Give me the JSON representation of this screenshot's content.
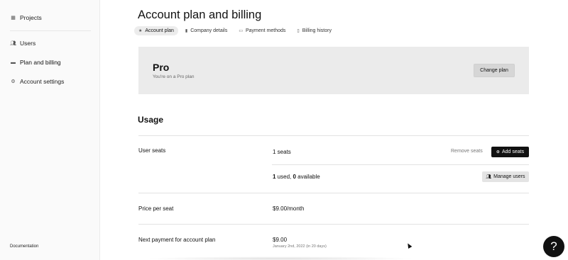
{
  "sidebar": {
    "items": [
      {
        "label": "Projects",
        "icon": "grid-icon"
      },
      {
        "label": "Users",
        "icon": "users-icon"
      },
      {
        "label": "Plan and billing",
        "icon": "card-icon"
      },
      {
        "label": "Account settings",
        "icon": "gear-icon"
      }
    ],
    "active": "Plan and billing",
    "footer_link": "Documentation"
  },
  "page": {
    "title": "Account plan and billing",
    "tabs": [
      {
        "label": "Account plan",
        "icon": "star-icon",
        "active": true
      },
      {
        "label": "Company details",
        "icon": "bookmark-icon",
        "active": false
      },
      {
        "label": "Payment methods",
        "icon": "card-icon",
        "active": false
      },
      {
        "label": "Billing history",
        "icon": "receipt-icon",
        "active": false
      }
    ]
  },
  "plan": {
    "name": "Pro",
    "subtitle": "You're on a Pro plan",
    "change_button": "Change plan"
  },
  "usage": {
    "title": "Usage",
    "user_seats": {
      "label": "User seats",
      "seats_count": "1",
      "seats_suffix": " seats",
      "used": "1",
      "used_suffix": " used, ",
      "available": "0",
      "available_suffix": " available",
      "remove_button": "Remove seats",
      "add_button": "Add seats",
      "manage_button": "Manage users"
    },
    "price_per_seat": {
      "label": "Price per seat",
      "value": "$9.00/month"
    },
    "next_payment": {
      "label": "Next payment for account plan",
      "value": "$9.00",
      "date": "January 2nd, 2022 (in 20 days)"
    }
  },
  "help": {
    "label": "?"
  },
  "colors": {
    "sidebar_bg": "#fafafa",
    "card_bg": "#ebebeb",
    "primary_button": "#111111"
  }
}
